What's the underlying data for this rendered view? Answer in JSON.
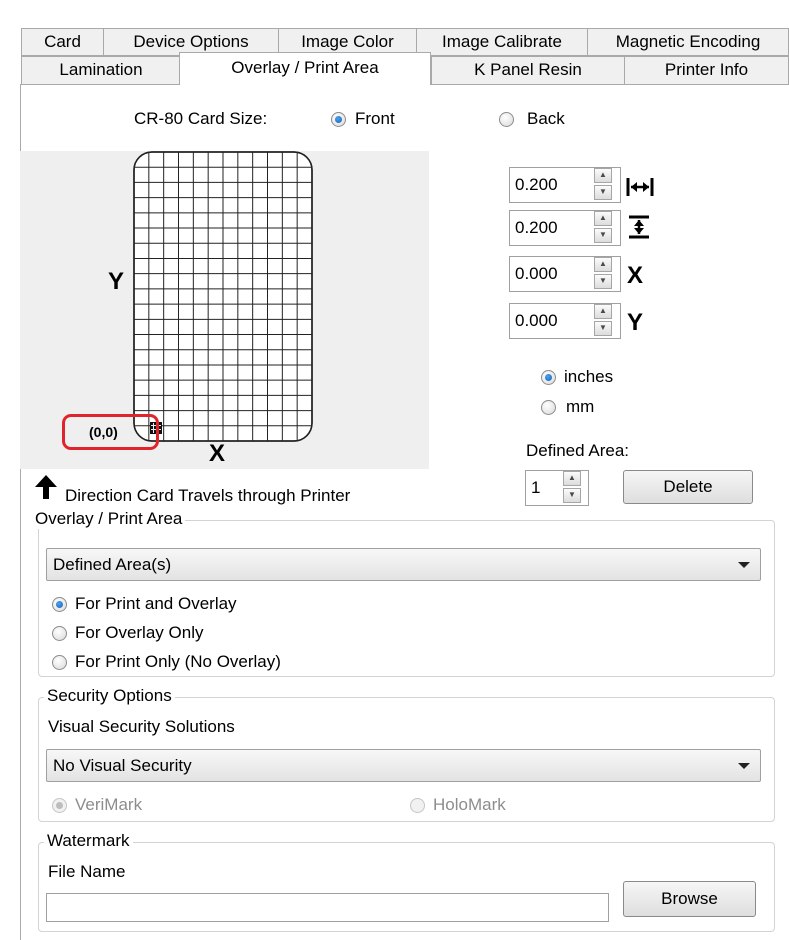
{
  "tabs_row1": [
    {
      "label": "Card"
    },
    {
      "label": "Device Options"
    },
    {
      "label": "Image Color"
    },
    {
      "label": "Image Calibrate"
    },
    {
      "label": "Magnetic Encoding"
    }
  ],
  "tabs_row2": [
    {
      "label": "Lamination"
    },
    {
      "label": "Overlay / Print Area",
      "active": true
    },
    {
      "label": "K Panel Resin"
    },
    {
      "label": "Printer Info"
    }
  ],
  "card_size": {
    "label": "CR-80 Card Size:",
    "front_label": "Front",
    "back_label": "Back",
    "selected": "Front"
  },
  "preview": {
    "y_label": "Y",
    "x_label": "X",
    "origin_label": "(0,0)",
    "direction_text": "Direction Card Travels through Printer",
    "highlight_color": "#e0242b"
  },
  "area_fields": [
    {
      "value": "0.200",
      "icon": "width-arrows-icon"
    },
    {
      "value": "0.200",
      "icon": "height-arrows-icon",
      "icon_glyph": "Ī"
    },
    {
      "value": "0.000",
      "icon": "x-offset-icon",
      "icon_glyph": "X"
    },
    {
      "value": "0.000",
      "icon": "y-offset-icon",
      "icon_glyph": "Y"
    }
  ],
  "units": {
    "inches_label": "inches",
    "mm_label": "mm",
    "selected": "inches"
  },
  "defined_area": {
    "label": "Defined Area:",
    "value": "1",
    "delete_label": "Delete"
  },
  "overlay_group": {
    "legend": "Overlay / Print Area",
    "dropdown_value": "Defined Area(s)",
    "options": [
      {
        "label": "For Print and Overlay",
        "checked": true
      },
      {
        "label": "For Overlay Only",
        "checked": false
      },
      {
        "label": "For Print Only (No Overlay)",
        "checked": false
      }
    ]
  },
  "security_group": {
    "legend": "Security Options",
    "subtitle": "Visual Security Solutions",
    "dropdown_value": "No Visual Security",
    "verimark_label": "VeriMark",
    "holomark_label": "HoloMark"
  },
  "watermark_group": {
    "legend": "Watermark",
    "file_name_label": "File Name",
    "file_name_value": "",
    "browse_label": "Browse"
  }
}
